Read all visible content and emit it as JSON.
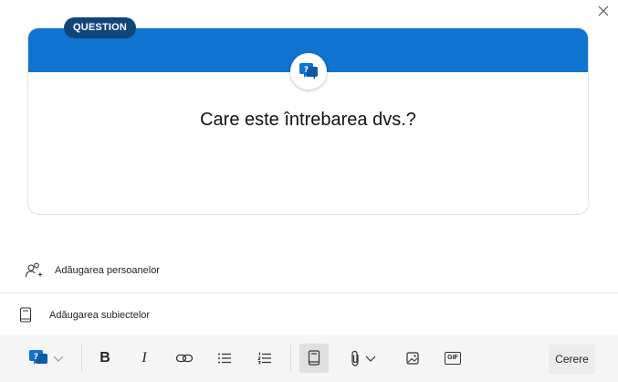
{
  "dialog": {
    "close_glyph": "×"
  },
  "card": {
    "badge": "QUESTION",
    "question": "Care este întrebarea dvs.?",
    "header_color": "#0f73d1",
    "badge_color": "#10457a",
    "icon": "question-bubble-icon"
  },
  "actions": {
    "add_people": "Adăugarea persoanelor",
    "add_topics": "Adăugarea subiectelor"
  },
  "toolbar": {
    "post_type_icon": "question-bubble-icon",
    "bold": "B",
    "italic": "I",
    "gif": "GIF",
    "send_label": "Cerere"
  }
}
